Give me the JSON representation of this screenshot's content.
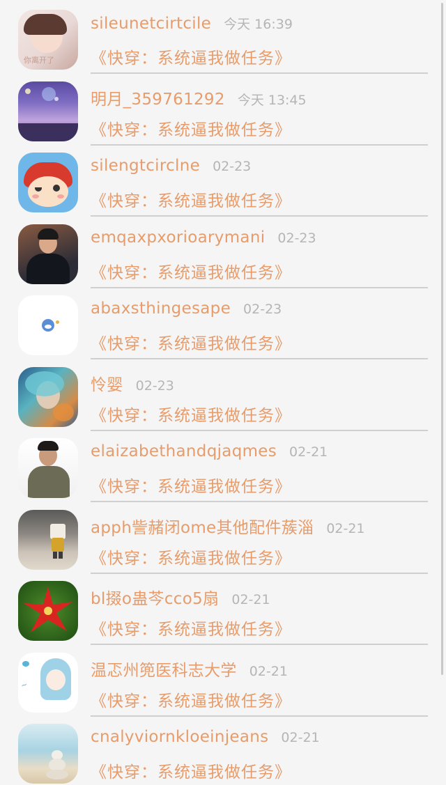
{
  "conversations": [
    {
      "name": "sileunetcirtcile",
      "time": "今天 16:39",
      "message": "《快穿：系统逼我做任务》",
      "avatar_caption": "你离开了"
    },
    {
      "name": "明月_359761292",
      "time": "今天 13:45",
      "message": "《快穿：系统逼我做任务》"
    },
    {
      "name": "silengtcirclne",
      "time": "02-23",
      "message": "《快穿：系统逼我做任务》"
    },
    {
      "name": "emqaxpxorioarymani",
      "time": "02-23",
      "message": "《快穿：系统逼我做任务》"
    },
    {
      "name": "abaxsthingesape",
      "time": "02-23",
      "message": "《快穿：系统逼我做任务》"
    },
    {
      "name": "怜婴",
      "time": "02-23",
      "message": "《快穿：系统逼我做任务》"
    },
    {
      "name": "elaizabethandqjaqmes",
      "time": "02-21",
      "message": "《快穿：系统逼我做任务》"
    },
    {
      "name": "apph訾赭闭ome其他配件蔟淄",
      "time": "02-21",
      "message": "《快穿：系统逼我做任务》"
    },
    {
      "name": "bl掇o蛊芩cco5扇",
      "time": "02-21",
      "message": "《快穿：系统逼我做任务》"
    },
    {
      "name": "温忑州篼医科志大学",
      "time": "02-21",
      "message": "《快穿：系统逼我做任务》"
    },
    {
      "name": "cnalyviornkloeinjeans",
      "time": "02-21",
      "message": "《快穿：系统逼我做任务》"
    }
  ],
  "colors": {
    "name": "#e69c6b",
    "message": "#e69c6b",
    "time": "#b5b5b5",
    "divider": "#cfcfcf",
    "background": "#f6f5f5"
  }
}
